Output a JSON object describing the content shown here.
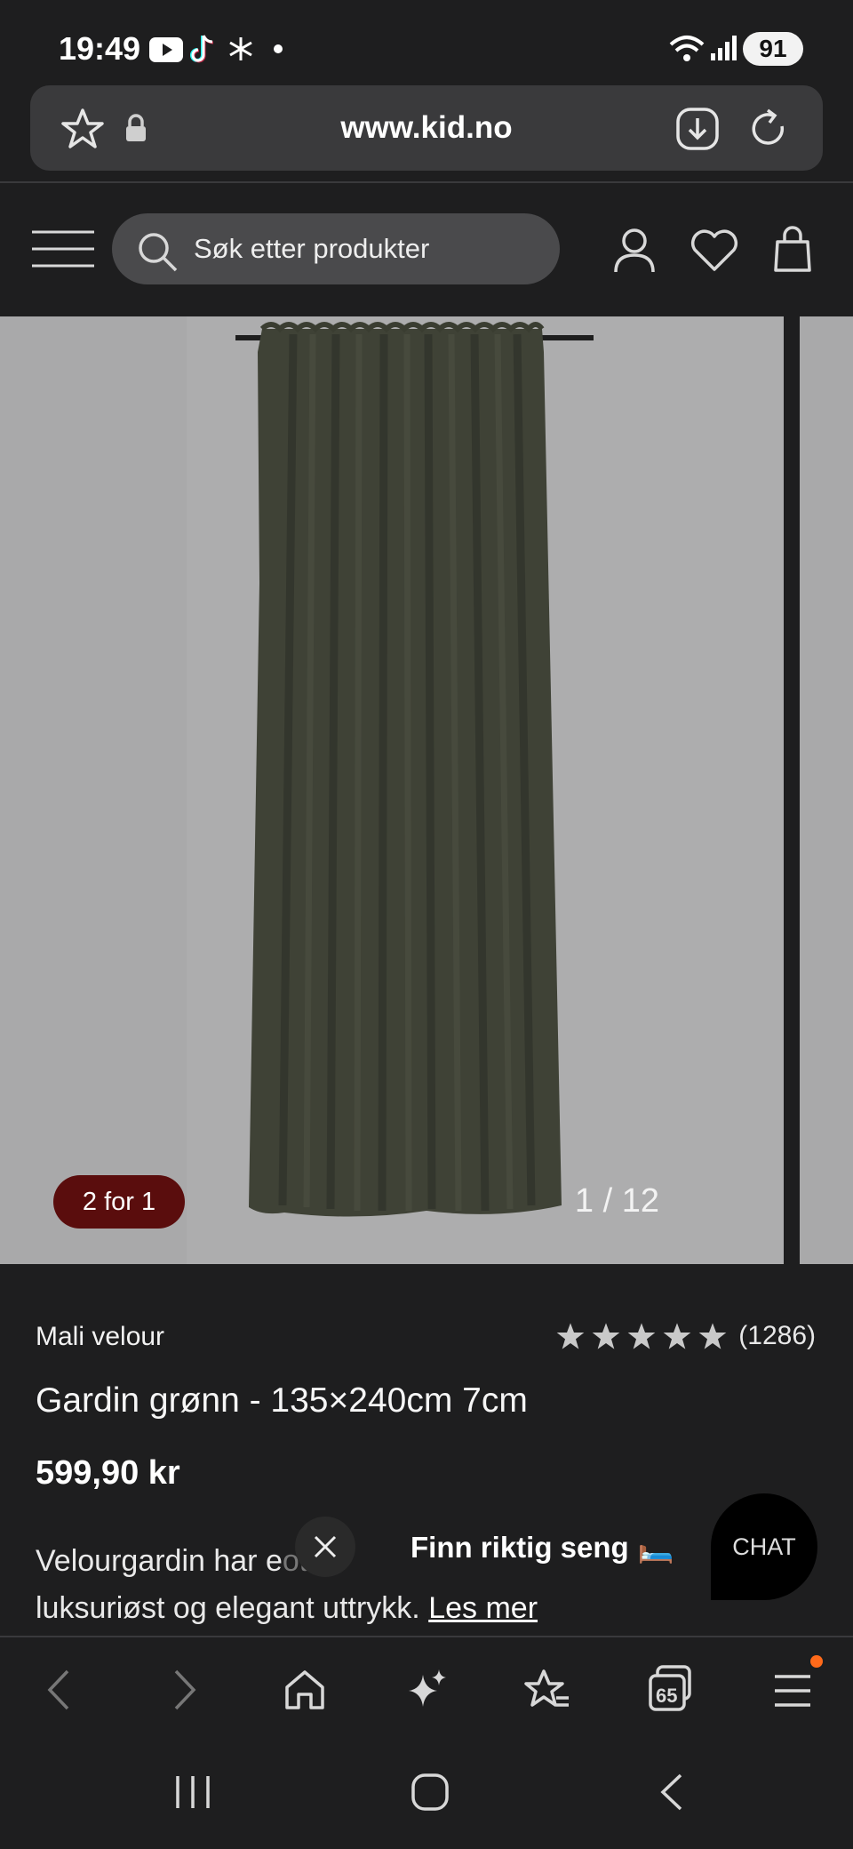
{
  "status_bar": {
    "time": "19:49",
    "battery": "91",
    "icons": [
      "youtube-icon",
      "tiktok-icon",
      "snowflake-icon",
      "dot-icon",
      "wifi-icon",
      "signal-icon"
    ]
  },
  "url_bar": {
    "url": "www.kid.no",
    "icons": [
      "star-icon",
      "lock-icon",
      "download-icon",
      "reload-icon"
    ]
  },
  "site_header": {
    "search_placeholder": "Søk etter produkter",
    "icons": [
      "menu-icon",
      "search-icon",
      "account-icon",
      "wishlist-icon",
      "cart-icon"
    ]
  },
  "gallery": {
    "badge": "2 for 1",
    "counter": "1 / 12",
    "image": "curtain-image"
  },
  "product": {
    "brand": "Mali velour",
    "rating_stars": 5,
    "rating_count": "(1286)",
    "title": "Gardin grønn - 135×240cm 7cm",
    "price": "599,90 kr",
    "description_start": "Velourgardin har e",
    "description_hidden": "otu",
    "description_line2": "luksuriøst og elegant uttrykk.",
    "read_more": "Les mer"
  },
  "overlay": {
    "toast_text": "Finn riktig seng",
    "toast_emoji": "🛏️",
    "chat_label": "CHAT"
  },
  "browser_bar": {
    "tab_count": "65",
    "icons": [
      "back-icon",
      "forward-icon",
      "home-icon",
      "sparkle-icon",
      "bookmarks-icon",
      "tabs-icon",
      "menu-icon"
    ]
  },
  "colors": {
    "background": "#1e1e1f",
    "badge": "#5a0d0d",
    "image_bg": "#a9a9aa",
    "notification": "#ff6a1a"
  }
}
